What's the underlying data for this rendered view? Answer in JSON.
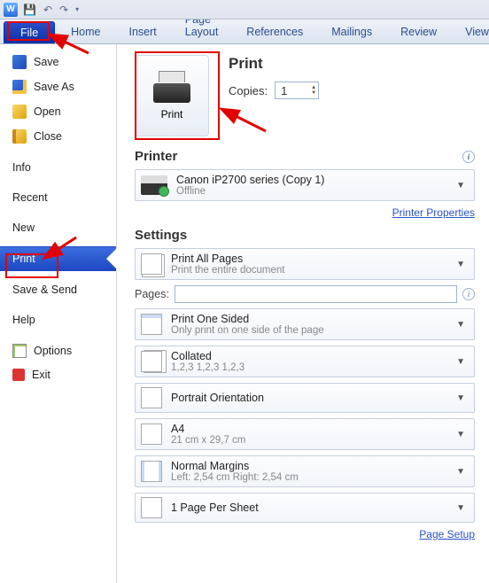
{
  "titlebar": {
    "app_icon_letter": "W"
  },
  "menubar": {
    "tabs": [
      "File",
      "Home",
      "Insert",
      "Page Layout",
      "References",
      "Mailings",
      "Review",
      "View"
    ]
  },
  "sidebar": {
    "items": [
      {
        "label": "Save",
        "icon": "disk"
      },
      {
        "label": "Save As",
        "icon": "saveas"
      },
      {
        "label": "Open",
        "icon": "open"
      },
      {
        "label": "Close",
        "icon": "close"
      }
    ],
    "noicon_items_top": [
      "Info",
      "Recent",
      "New"
    ],
    "active": "Print",
    "noicon_items_bottom": [
      "Save & Send",
      "Help"
    ],
    "footer": [
      {
        "label": "Options",
        "icon": "opt"
      },
      {
        "label": "Exit",
        "icon": "exit"
      }
    ]
  },
  "content": {
    "print_heading": "Print",
    "print_button_label": "Print",
    "copies_label": "Copies:",
    "copies_value": "1",
    "printer_head": "Printer",
    "printer_name": "Canon iP2700 series (Copy 1)",
    "printer_status": "Offline",
    "printer_props_link": "Printer Properties",
    "settings_head": "Settings",
    "dd": [
      {
        "t1": "Print All Pages",
        "t2": "Print the entire document",
        "icon": "pages"
      },
      null,
      {
        "t1": "Print One Sided",
        "t2": "Only print on one side of the page",
        "icon": "oneside"
      },
      {
        "t1": "Collated",
        "t2": "1,2,3   1,2,3   1,2,3",
        "icon": "collate"
      },
      {
        "t1": "Portrait Orientation",
        "t2": "",
        "icon": "portrait"
      },
      {
        "t1": "A4",
        "t2": "21 cm x 29,7 cm",
        "icon": "a4"
      },
      {
        "t1": "Normal Margins",
        "t2": "Left:  2,54 cm   Right:  2,54 cm",
        "icon": "margins"
      },
      {
        "t1": "1 Page Per Sheet",
        "t2": "",
        "icon": "1pps"
      }
    ],
    "pages_label": "Pages:",
    "page_setup_link": "Page Setup"
  }
}
